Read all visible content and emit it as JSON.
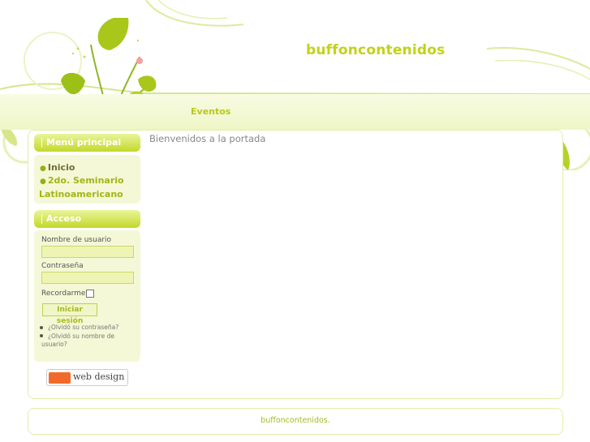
{
  "site": {
    "title": "buffoncontenidos"
  },
  "nav": {
    "items": [
      {
        "label": "Eventos"
      }
    ]
  },
  "main": {
    "welcome": "Bienvenidos a la portada"
  },
  "menu": {
    "title": "Menú principal",
    "items": [
      {
        "label": "Inicio",
        "active": true
      },
      {
        "label_line1": "2do. Seminario",
        "label_line2": "Latinoamericano"
      }
    ]
  },
  "login": {
    "title": "Acceso",
    "username_label": "Nombre de usuario",
    "password_label": "Contraseña",
    "remember_label": "Recordarme",
    "remember_checked": false,
    "submit_label": "Iniciar sesión",
    "forgot_password": "¿Olvidó su contraseña?",
    "forgot_username_line1": "¿Olvidó su nombre de",
    "forgot_username_line2": "usuario?"
  },
  "badge": {
    "label": "web design"
  },
  "footer": {
    "text": "buffoncontenidos."
  },
  "colors": {
    "accent": "#c2d21a",
    "panel": "#f4f8d6",
    "leaf": "#a9c71b"
  }
}
